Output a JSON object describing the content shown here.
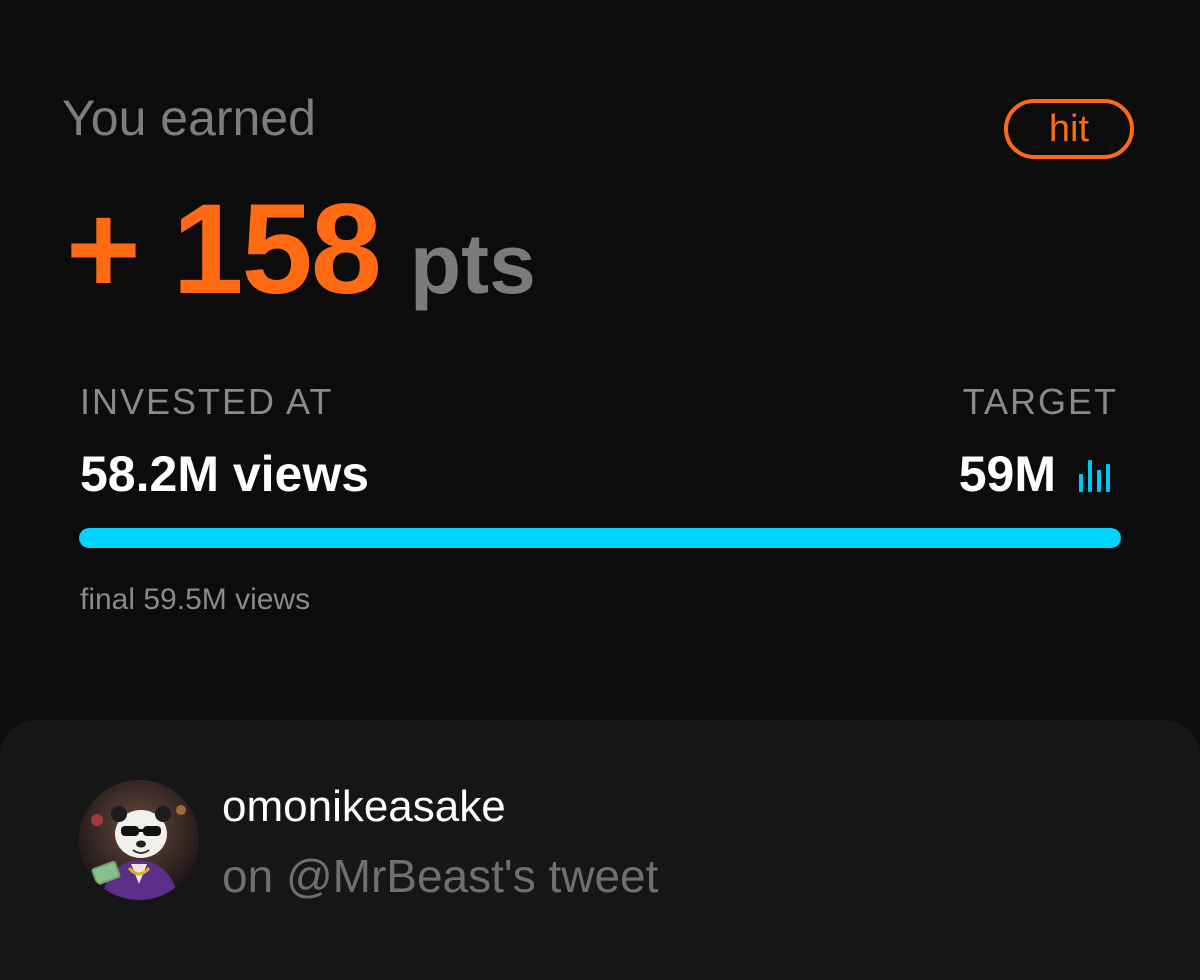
{
  "header": {
    "label": "You earned",
    "status_badge": "hit",
    "points_value": "+ 158",
    "points_unit": "pts"
  },
  "investment": {
    "invested_label": "INVESTED AT",
    "invested_value": "58.2M views",
    "target_label": "TARGET",
    "target_value": "59M",
    "target_icon": "bar-chart-icon",
    "progress": 1.0,
    "final_text": "final 59.5M views"
  },
  "post": {
    "avatar_icon": "panda-avatar",
    "username": "omonikeasake",
    "context": "on @MrBeast's tweet"
  },
  "colors": {
    "background": "#0c0c0c",
    "accent": "#ff6a13",
    "progress": "#00d4ff",
    "card": "#161616"
  }
}
